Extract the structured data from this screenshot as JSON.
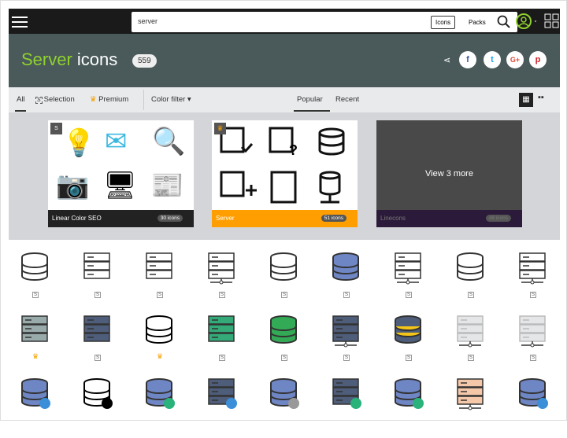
{
  "header": {
    "search_value": "server",
    "icons_label": "Icons",
    "packs_label": "Packs"
  },
  "hero": {
    "title_highlight": "Server",
    "title_rest": " icons",
    "count": "559",
    "social": [
      "f",
      "t",
      "G+",
      "p"
    ]
  },
  "filters": {
    "all": "All",
    "selection": "Selection",
    "premium": "Premium",
    "color_filter": "Color filter ▾",
    "popular": "Popular",
    "recent": "Recent",
    "selection_badge": "S"
  },
  "packs": [
    {
      "name": "Linear Color SEO",
      "count": "30 icons",
      "footer_color": "#222222",
      "badge": "S"
    },
    {
      "name": "Server",
      "count": "51 icons",
      "footer_color": "#ff9e00",
      "badge": "♛"
    },
    {
      "name": "Linecons",
      "count": "48 icons",
      "footer_color": "#2b1a3a",
      "overlay": "View 3 more"
    }
  ],
  "colors": {
    "accent": "#8fd12e",
    "premium": "#f5a100"
  },
  "icon_rows": [
    [
      {
        "icon": "database-outline",
        "tag": "S"
      },
      {
        "icon": "server-outline",
        "tag": "S"
      },
      {
        "icon": "server-database-outline",
        "tag": "S"
      },
      {
        "icon": "server-network-outline",
        "tag": "S"
      },
      {
        "icon": "databases-outline",
        "tag": "S"
      },
      {
        "icon": "database-blue",
        "tag": "S"
      },
      {
        "icon": "server-network-outline",
        "tag": "S"
      },
      {
        "icon": "database-dotted",
        "tag": "S"
      },
      {
        "icon": "server-network-dashed",
        "tag": "S"
      }
    ],
    [
      {
        "icon": "server-rack-grey",
        "tag": "crown"
      },
      {
        "icon": "server-navy",
        "tag": "S"
      },
      {
        "icon": "database-black",
        "tag": "crown"
      },
      {
        "icon": "server-green",
        "tag": "S"
      },
      {
        "icon": "databases-green",
        "tag": "S"
      },
      {
        "icon": "server-network-navy",
        "tag": "S"
      },
      {
        "icon": "database-yellow",
        "tag": "S"
      },
      {
        "icon": "server-network-light",
        "tag": "S"
      },
      {
        "icon": "server-network-light",
        "tag": "S"
      }
    ],
    [
      {
        "icon": "database-cloud",
        "tag": ""
      },
      {
        "icon": "database-sync",
        "tag": ""
      },
      {
        "icon": "database-check",
        "tag": ""
      },
      {
        "icon": "server-cloud",
        "tag": ""
      },
      {
        "icon": "database-gear",
        "tag": ""
      },
      {
        "icon": "server-check",
        "tag": ""
      },
      {
        "icon": "database-add",
        "tag": ""
      },
      {
        "icon": "server-network-orange",
        "tag": ""
      },
      {
        "icon": "database-refresh",
        "tag": ""
      }
    ]
  ]
}
